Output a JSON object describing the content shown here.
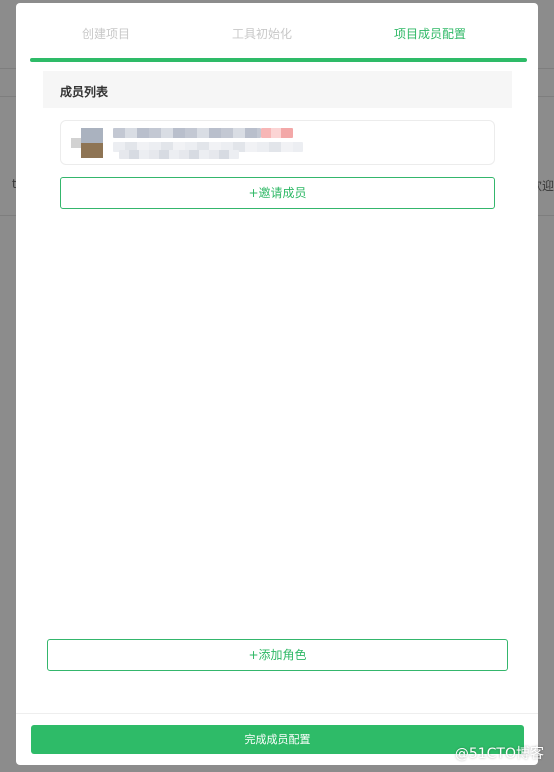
{
  "background": {
    "left_edge_text": "t",
    "right_edge_text": "欢迎"
  },
  "steps": [
    {
      "label": "创建项目",
      "active": false
    },
    {
      "label": "工具初始化",
      "active": false
    },
    {
      "label": "项目成员配置",
      "active": true
    }
  ],
  "member_list": {
    "title": "成员列表"
  },
  "buttons": {
    "invite": "+邀请成员",
    "add_role": "+添加角色",
    "finish": "完成成员配置"
  },
  "watermark": "@51CTO博客",
  "colors": {
    "accent": "#2ebb68",
    "active_step_text": "#2fb866",
    "inactive_step_text": "#c8c8c8"
  }
}
